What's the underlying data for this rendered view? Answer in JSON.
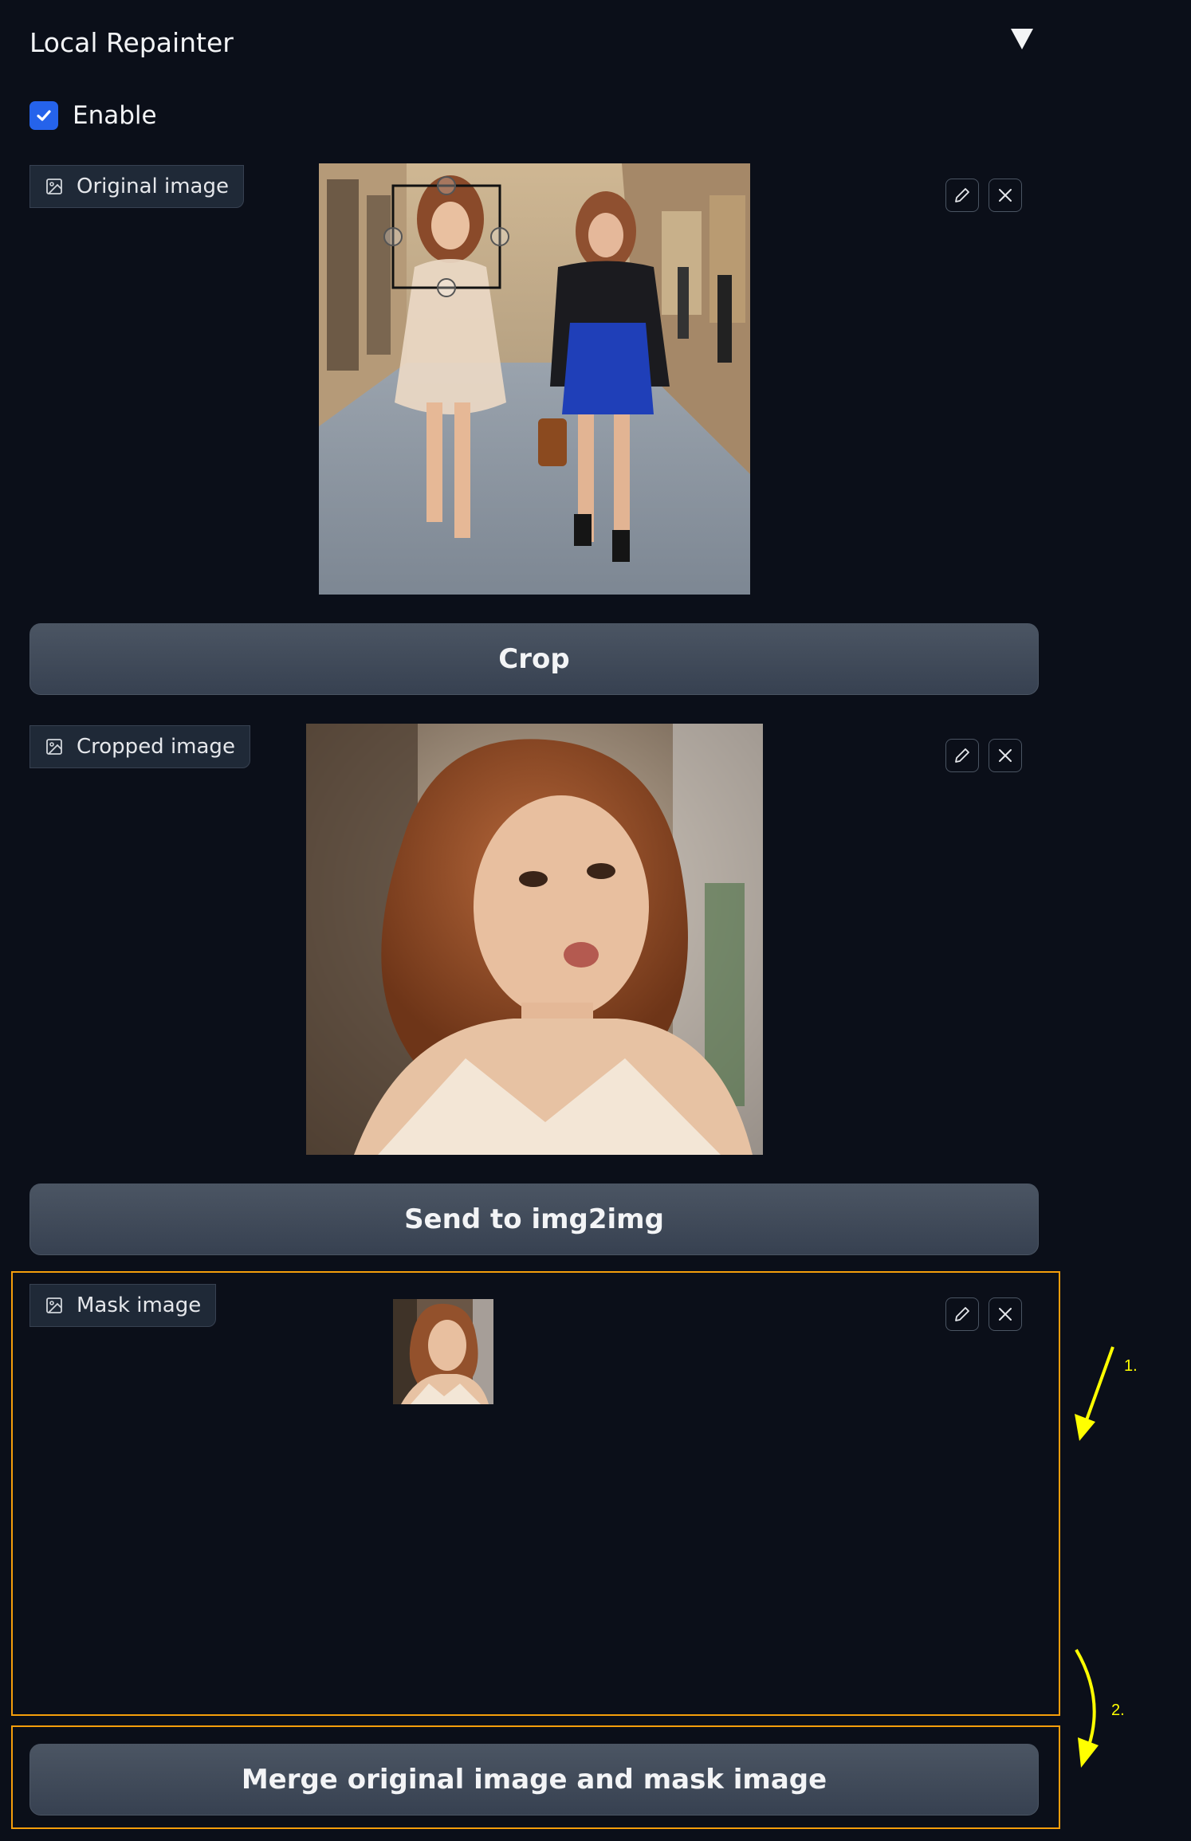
{
  "panel": {
    "title": "Local Repainter",
    "enable_label": "Enable",
    "enable_checked": true
  },
  "original": {
    "label": "Original image"
  },
  "crop_button": "Crop",
  "cropped": {
    "label": "Cropped image"
  },
  "send_button": "Send to img2img",
  "mask": {
    "label": "Mask image"
  },
  "merge_button": "Merge original image and mask image",
  "annotations": {
    "step1": "1.",
    "step2": "2."
  },
  "colors": {
    "background": "#0b0f19",
    "accent": "#2563eb",
    "highlight": "#f59e0b",
    "annotation": "#ffff00"
  },
  "icons": [
    "image-icon",
    "edit-icon",
    "close-icon",
    "check-icon",
    "collapse-triangle-icon"
  ]
}
